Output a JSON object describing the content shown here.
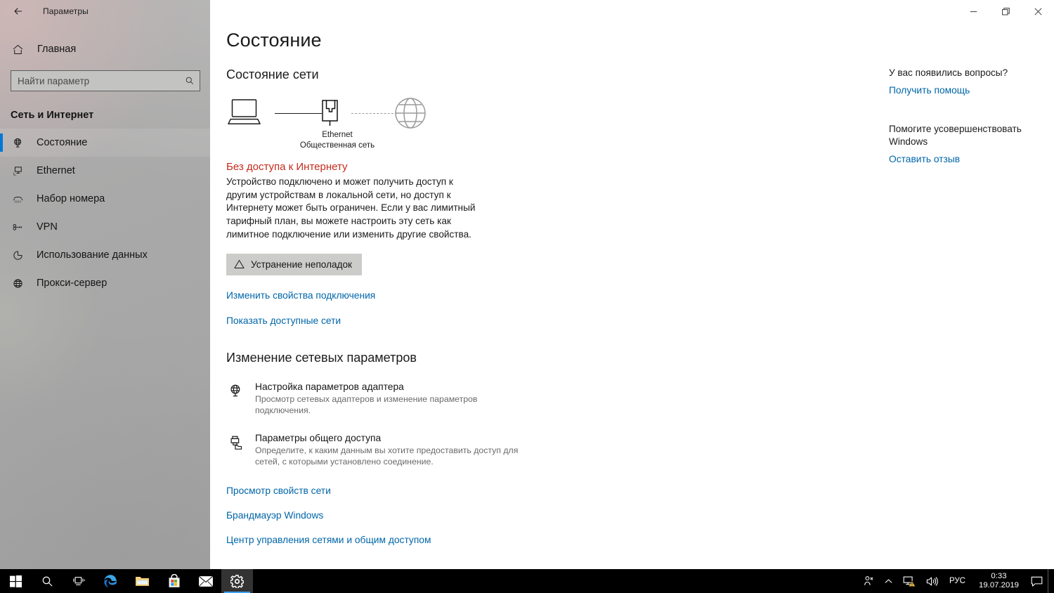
{
  "window": {
    "title": "Параметры",
    "back_label": "back-arrow",
    "controls": {
      "minimize": "minimize",
      "restore": "restore",
      "close": "close"
    }
  },
  "sidebar": {
    "home_label": "Главная",
    "search": {
      "placeholder": "Найти параметр",
      "value": ""
    },
    "category": "Сеть и Интернет",
    "items": [
      {
        "label": "Состояние",
        "icon": "globe-monitor-icon",
        "active": true
      },
      {
        "label": "Ethernet",
        "icon": "ethernet-monitor-icon",
        "active": false
      },
      {
        "label": "Набор номера",
        "icon": "dialup-phone-icon",
        "active": false
      },
      {
        "label": "VPN",
        "icon": "vpn-key-icon",
        "active": false
      },
      {
        "label": "Использование данных",
        "icon": "data-usage-pie-icon",
        "active": false
      },
      {
        "label": "Прокси-сервер",
        "icon": "globe-icon",
        "active": false
      }
    ]
  },
  "main": {
    "page_title": "Состояние",
    "network_status": {
      "heading": "Состояние сети",
      "diagram": {
        "device_icon": "laptop-icon",
        "connection_icon": "ethernet-port-icon",
        "internet_icon": "globe-icon",
        "connection_name": "Ethernet",
        "network_profile": "Общественная сеть",
        "link1_style": "solid",
        "link2_style": "dashed"
      },
      "status_title": "Без доступа к Интернету",
      "status_color": "#c42b1c",
      "status_description": "Устройство подключено и может получить доступ к другим устройствам в локальной сети, но доступ к Интернету может быть ограничен. Если у вас лимитный тарифный план, вы можете настроить эту сеть как лимитное подключение или изменить другие свойства.",
      "troubleshoot_button": "Устранение неполадок",
      "troubleshoot_icon": "warning-triangle-icon",
      "links": [
        "Изменить свойства подключения",
        "Показать доступные сети"
      ]
    },
    "change_settings": {
      "heading": "Изменение сетевых параметров",
      "rows": [
        {
          "icon": "adapter-globe-monitor-icon",
          "title": "Настройка параметров адаптера",
          "subtitle": "Просмотр сетевых адаптеров и изменение параметров подключения."
        },
        {
          "icon": "printer-folder-share-icon",
          "title": "Параметры общего доступа",
          "subtitle": "Определите, к каким данным вы хотите предоставить доступ для сетей, с которыми установлено соединение."
        }
      ],
      "links": [
        "Просмотр свойств сети",
        "Брандмауэр Windows",
        "Центр управления сетями и общим доступом"
      ]
    }
  },
  "help_panel": {
    "question_heading": "У вас появились вопросы?",
    "question_link": "Получить помощь",
    "improve_heading": "Помогите усовершенствовать Windows",
    "improve_link": "Оставить отзыв"
  },
  "taskbar": {
    "buttons": [
      {
        "name": "start",
        "icon": "windows-logo-icon",
        "active": false
      },
      {
        "name": "search",
        "icon": "search-icon",
        "active": false
      },
      {
        "name": "task-view",
        "icon": "task-view-icon",
        "active": false
      },
      {
        "name": "edge",
        "icon": "edge-browser-icon",
        "active": false
      },
      {
        "name": "file-explorer",
        "icon": "folder-icon",
        "active": false
      },
      {
        "name": "microsoft-store",
        "icon": "store-bag-icon",
        "active": false
      },
      {
        "name": "mail",
        "icon": "mail-envelope-icon",
        "active": false
      },
      {
        "name": "settings",
        "icon": "gear-icon",
        "active": true
      }
    ],
    "tray": {
      "people_icon": "people-icon",
      "chevron_icon": "chevron-up-icon",
      "network_icon": "network-warning-icon",
      "volume_icon": "speaker-icon",
      "language": "РУС",
      "time": "0:33",
      "date": "19.07.2019",
      "action_center_icon": "action-center-icon"
    }
  },
  "colors": {
    "accent": "#0078d7",
    "link": "#0066a8",
    "error": "#c42b1c",
    "sidebar": "#a9a9a8",
    "taskbar": "#000000"
  }
}
